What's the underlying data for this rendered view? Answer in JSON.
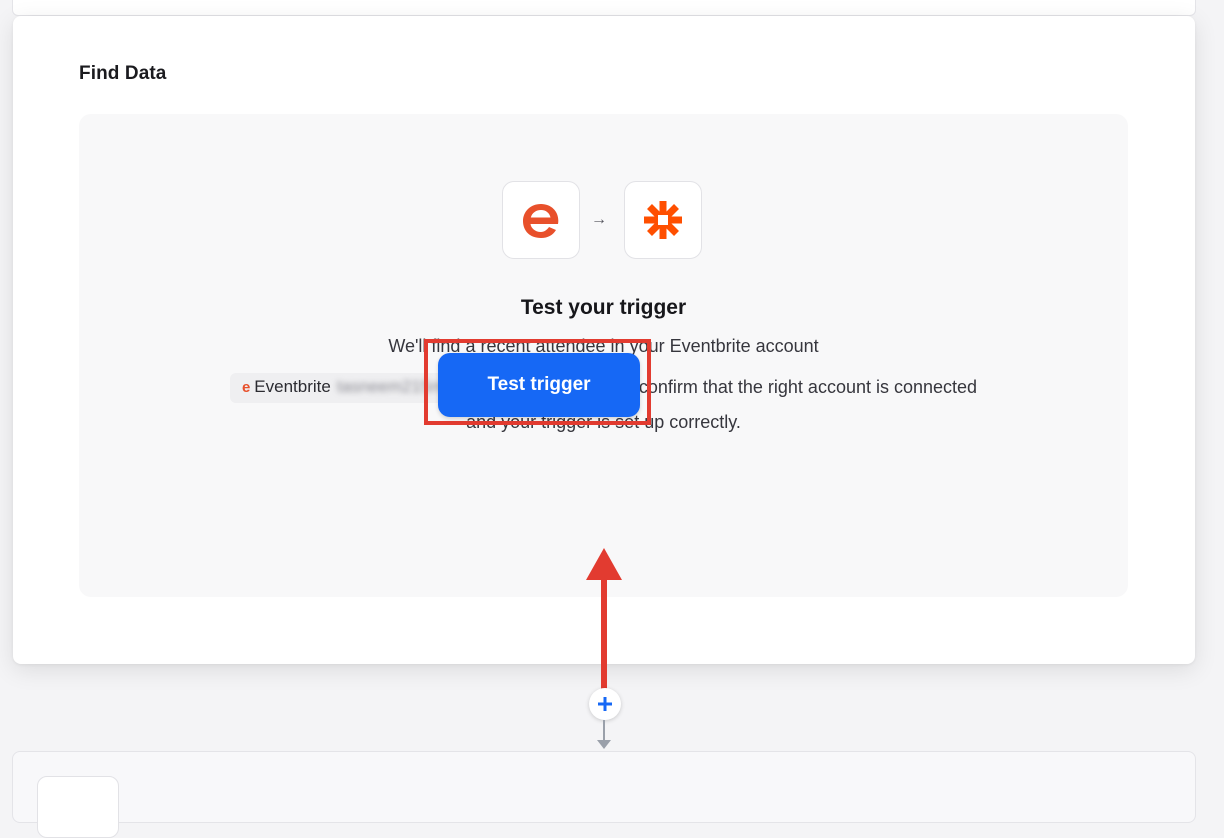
{
  "step": {
    "section_title": "Find Data",
    "title": "Test your trigger",
    "description_line1": "We'll find a recent attendee in your Eventbrite account",
    "account": {
      "app_letter": "e",
      "app_name": "Eventbrite",
      "email": "tasneem215muchhala@gmail.com"
    },
    "description_line2_suffix": "to confirm that the right account is connected",
    "description_line3": "and your trigger is set up correctly.",
    "button_label": "Test trigger"
  },
  "icons": {
    "trigger_app": "eventbrite-logo-icon",
    "flow_arrow": "arrow-right-icon",
    "action_app": "zapier-logo-icon",
    "add_step": "plus-icon"
  },
  "colors": {
    "primary_button": "#1668f5",
    "annotation_red": "#e23b30",
    "eventbrite_orange": "#e8502b",
    "zapier_orange": "#ff4f00"
  }
}
